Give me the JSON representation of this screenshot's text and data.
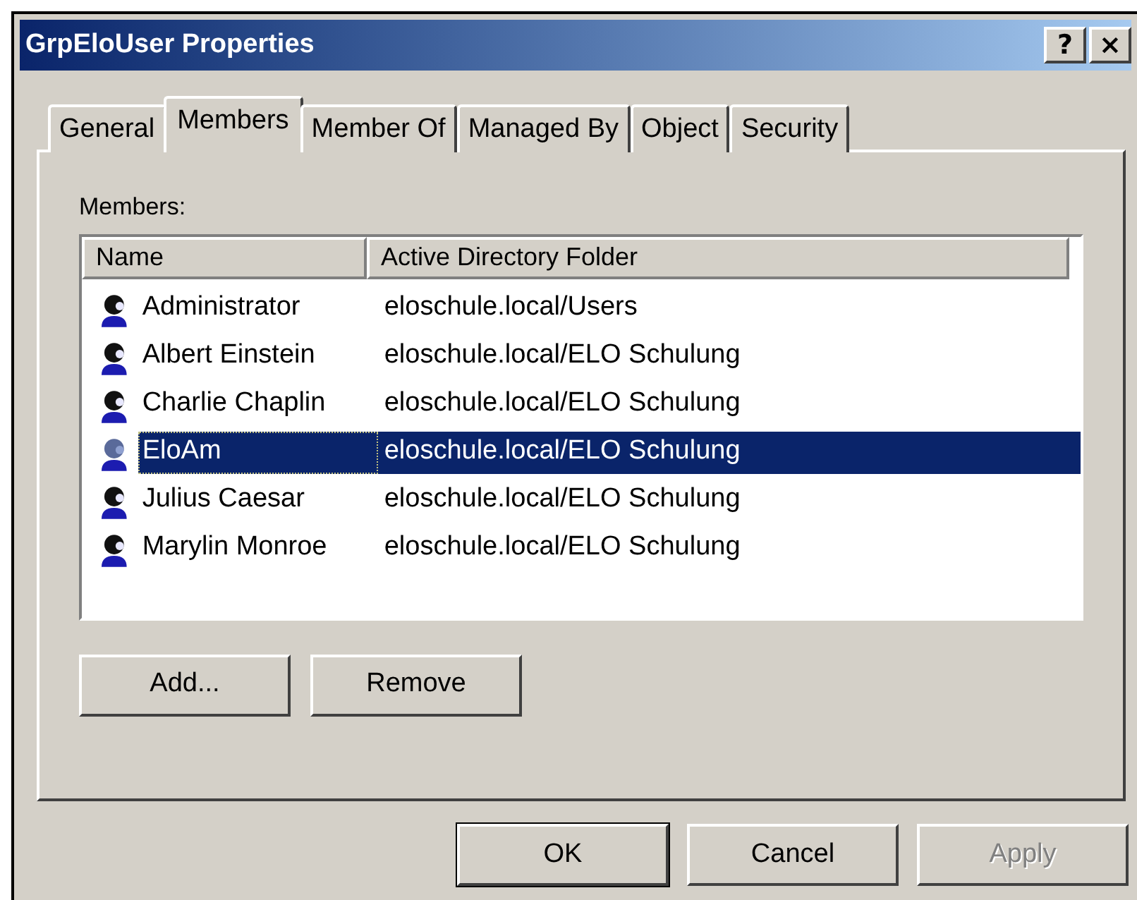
{
  "window": {
    "title": "GrpEloUser Properties",
    "title_buttons": [
      "?",
      "×"
    ]
  },
  "tabs": [
    {
      "label": "General",
      "selected": false
    },
    {
      "label": "Members",
      "selected": true
    },
    {
      "label": "Member Of",
      "selected": false
    },
    {
      "label": "Managed By",
      "selected": false
    },
    {
      "label": "Object",
      "selected": false
    },
    {
      "label": "Security",
      "selected": false
    }
  ],
  "members_label": "Members:",
  "table": {
    "columns": [
      "Name",
      "Active Directory Folder"
    ],
    "rows": [
      {
        "name": "Administrator",
        "folder": "eloschule.local/Users",
        "selected": false
      },
      {
        "name": "Albert Einstein",
        "folder": "eloschule.local/ELO Schulung",
        "selected": false
      },
      {
        "name": "Charlie Chaplin",
        "folder": "eloschule.local/ELO Schulung",
        "selected": false
      },
      {
        "name": "EloAm",
        "folder": "eloschule.local/ELO Schulung",
        "selected": true
      },
      {
        "name": "Julius Caesar",
        "folder": "eloschule.local/ELO Schulung",
        "selected": false
      },
      {
        "name": "Marylin Monroe",
        "folder": "eloschule.local/ELO Schulung",
        "selected": false
      }
    ]
  },
  "list_buttons": [
    {
      "label": "Add..."
    },
    {
      "label": "Remove"
    }
  ],
  "dialog_buttons": [
    {
      "label": "OK",
      "default": true,
      "disabled": false
    },
    {
      "label": "Cancel",
      "default": false,
      "disabled": false
    },
    {
      "label": "Apply",
      "default": false,
      "disabled": true
    }
  ]
}
